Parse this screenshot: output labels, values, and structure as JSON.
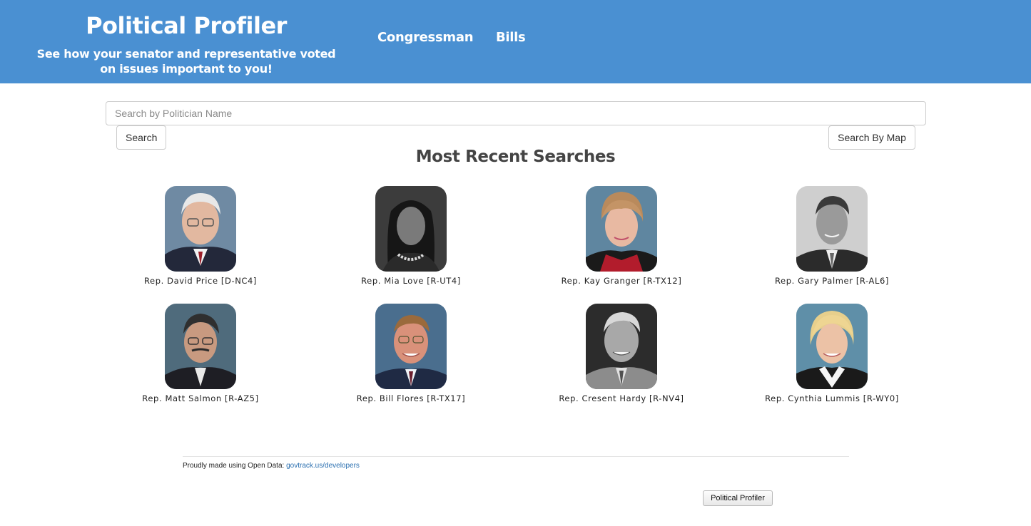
{
  "header": {
    "title": "Political Profiler",
    "tagline": "See how your senator and representative voted on issues important to you!",
    "nav": [
      {
        "label": "Congressman"
      },
      {
        "label": "Bills"
      }
    ],
    "background_color": "#4a90d2"
  },
  "search": {
    "placeholder": "Search by Politician Name",
    "value": "",
    "search_button": "Search",
    "map_button": "Search By Map"
  },
  "recent": {
    "heading": "Most Recent Searches",
    "politicians": [
      {
        "label": "Rep. David Price [D-NC4]",
        "photo": "grayscale-false"
      },
      {
        "label": "Rep. Mia Love [R-UT4]",
        "photo": "grayscale-true"
      },
      {
        "label": "Rep. Kay Granger [R-TX12]",
        "photo": "grayscale-false"
      },
      {
        "label": "Rep. Gary Palmer [R-AL6]",
        "photo": "grayscale-true"
      },
      {
        "label": "Rep. Matt Salmon [R-AZ5]",
        "photo": "grayscale-false"
      },
      {
        "label": "Rep. Bill Flores [R-TX17]",
        "photo": "grayscale-false"
      },
      {
        "label": "Rep. Cresent Hardy [R-NV4]",
        "photo": "grayscale-true"
      },
      {
        "label": "Rep. Cynthia Lummis [R-WY0]",
        "photo": "grayscale-false"
      }
    ]
  },
  "footer": {
    "text": "Proudly made using Open Data:",
    "link_text": "govtrack.us/developers",
    "button_label": "Political Profiler"
  }
}
